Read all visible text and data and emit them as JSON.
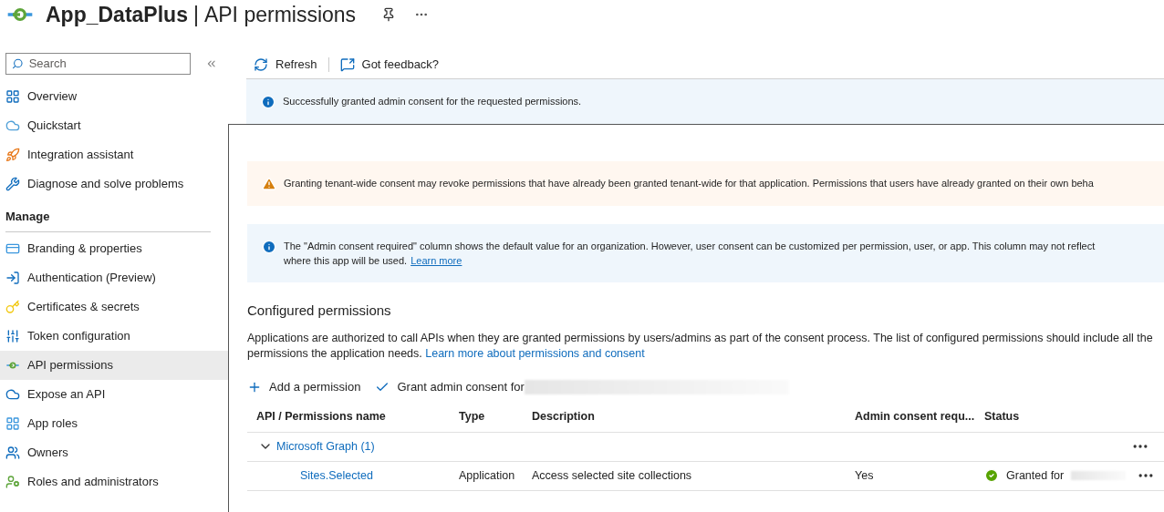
{
  "header": {
    "app_name": "App_DataPlus",
    "separator": "|",
    "page_title": "API permissions"
  },
  "sidebar": {
    "search": {
      "placeholder": "Search"
    },
    "items": [
      {
        "label": "Overview",
        "kind": "grid",
        "selected": false
      },
      {
        "label": "Quickstart",
        "kind": "cloud",
        "selected": false
      },
      {
        "label": "Integration assistant",
        "kind": "rocket",
        "selected": false
      },
      {
        "label": "Diagnose and solve problems",
        "kind": "wrench",
        "selected": false
      }
    ],
    "section": "Manage",
    "manage_items": [
      {
        "label": "Branding & properties",
        "kind": "card",
        "selected": false
      },
      {
        "label": "Authentication (Preview)",
        "kind": "auth",
        "selected": false
      },
      {
        "label": "Certificates & secrets",
        "kind": "key",
        "selected": false
      },
      {
        "label": "Token configuration",
        "kind": "bars",
        "selected": false
      },
      {
        "label": "API permissions",
        "kind": "api",
        "selected": true
      },
      {
        "label": "Expose an API",
        "kind": "cloud2",
        "selected": false
      },
      {
        "label": "App roles",
        "kind": "roles",
        "selected": false
      },
      {
        "label": "Owners",
        "kind": "people",
        "selected": false
      },
      {
        "label": "Roles and administrators",
        "kind": "admin",
        "selected": false
      }
    ]
  },
  "toolbar": [
    {
      "label": "Refresh",
      "kind": "refresh"
    },
    {
      "label": "Got feedback?",
      "kind": "feedback"
    }
  ],
  "notices": [
    {
      "kind": "info",
      "text": "Successfully granted admin consent for the requested permissions."
    },
    {
      "kind": "warning",
      "text": "Granting tenant-wide consent may revoke permissions that have already been granted tenant-wide for that application. Permissions that users have already granted on their own beha"
    },
    {
      "kind": "info",
      "text": "The \"Admin consent required\" column shows the default value for an organization. However, user consent can be customized per permission, user, or app. This column may not reflect",
      "text2": "where this app will be used.",
      "link": "Learn more"
    }
  ],
  "configured": {
    "title": "Configured permissions",
    "description": "Applications are authorized to call APIs when they are granted permissions by users/admins as part of the consent process. The list of configured permissions should include all the permissions the application needs.",
    "link": "Learn more about permissions and consent",
    "actions": [
      {
        "label": "Add a permission",
        "kind": "add"
      },
      {
        "label": "Grant admin consent for",
        "kind": "check"
      }
    ],
    "table": {
      "columns": [
        "API / Permissions name",
        "Type",
        "Description",
        "Admin consent requ...",
        "Status"
      ],
      "groups": [
        {
          "name": "Microsoft Graph (1)",
          "expanded": true,
          "rows": [
            {
              "name": "Sites.Selected",
              "type": "Application",
              "description": "Access selected site collections",
              "admin_consent": "Yes",
              "status": "Granted for",
              "granted": true
            }
          ]
        }
      ]
    }
  }
}
